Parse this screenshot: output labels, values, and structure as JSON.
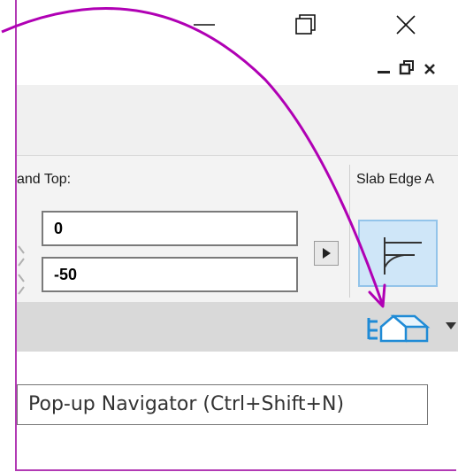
{
  "window": {
    "minimize_glyph": "—",
    "maximize_glyph": "❐",
    "close_glyph": "✕"
  },
  "mdi": {
    "minimize_glyph": "_",
    "restore_glyph": "🗗",
    "close_glyph": "x"
  },
  "panel": {
    "top_label": "and Top:",
    "slab_edge_label": "Slab Edge A",
    "field_top_value": "0",
    "field_bottom_value": "-50"
  },
  "status": {
    "navigator_icon": "navigator-tree-house-icon",
    "dropdown_icon": "chevron-down-icon"
  },
  "tooltip": {
    "text": "Pop-up Navigator  (Ctrl+Shift+N)"
  },
  "annotation": {
    "color": "#b000b4"
  }
}
